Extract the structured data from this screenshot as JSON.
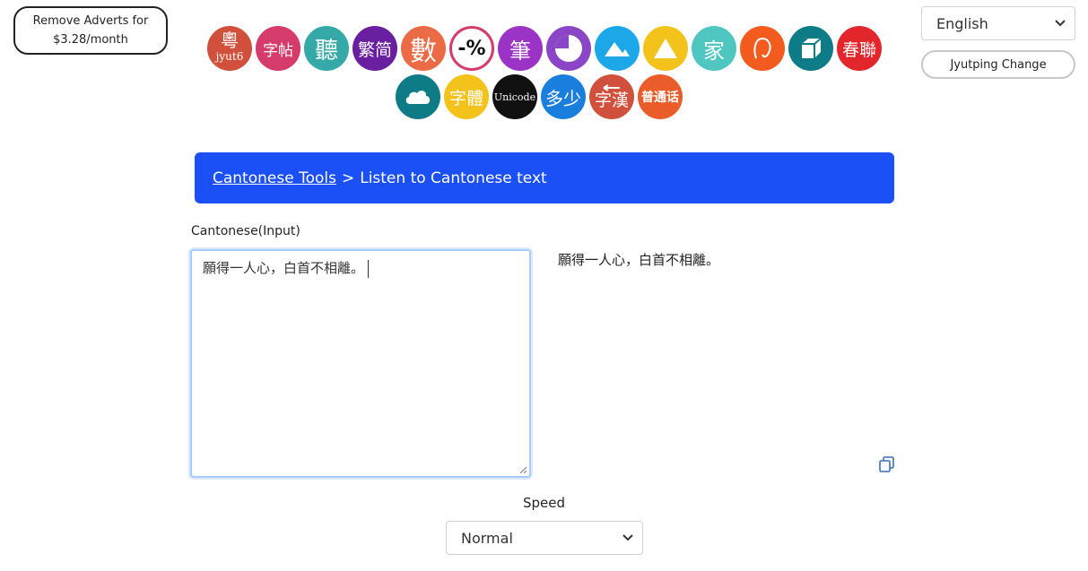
{
  "header": {
    "remove_ads_line1": "Remove Adverts for",
    "remove_ads_line2": "$3.28/month",
    "language": "English",
    "jyutping_button": "Jyutping Change"
  },
  "tool_icons": [
    {
      "name": "jyutping-tool-icon",
      "text": "粵",
      "sub": "jyut6",
      "color": "#d0503c"
    },
    {
      "name": "calligraphy-sheet-icon",
      "text": "字帖",
      "color": "#d53b6b"
    },
    {
      "name": "listen-icon",
      "text": "聽",
      "color": "#35a8a8"
    },
    {
      "name": "traditional-simplified-icon",
      "text": "繁简",
      "color": "#6a1fa0"
    },
    {
      "name": "numbers-icon",
      "text": "數",
      "color": "#ea6b45"
    },
    {
      "name": "percent-icon",
      "text": "-%",
      "color": "#ffffff"
    },
    {
      "name": "stroke-icon",
      "text": "筆",
      "color": "#9b33c6"
    },
    {
      "name": "pie-chart-icon",
      "text": "",
      "color": "#8a46c7"
    },
    {
      "name": "mountains-icon",
      "text": "",
      "color": "#1ba7e8"
    },
    {
      "name": "triangle-icon",
      "text": "",
      "color": "#f3c21b"
    },
    {
      "name": "family-icon",
      "text": "家",
      "color": "#4fc6c0"
    },
    {
      "name": "swirl-icon",
      "text": "",
      "color": "#f35c1e"
    },
    {
      "name": "cube-icon",
      "text": "",
      "color": "#0d7c86"
    },
    {
      "name": "spring-couplet-icon",
      "text": "春聯",
      "color": "#e3262b"
    },
    {
      "name": "cloud-icon",
      "text": "",
      "color": "#0d7c86"
    },
    {
      "name": "font-icon",
      "text": "字體",
      "color": "#f3c21b"
    },
    {
      "name": "unicode-icon",
      "text": "Unicode",
      "color": "#111111"
    },
    {
      "name": "count-icon",
      "text": "多少",
      "color": "#1a7fdc"
    },
    {
      "name": "chinese-character-icon",
      "text": "字漢",
      "color": "#d0503c"
    },
    {
      "name": "mandarin-icon",
      "text": "普通话",
      "color": "#ea5d2a"
    }
  ],
  "breadcrumb": {
    "link": "Cantonese Tools",
    "separator": ">",
    "current": "Listen to Cantonese text"
  },
  "input": {
    "label": "Cantonese(Input)",
    "value": "願得一人心，白首不相離。"
  },
  "output": {
    "text": "願得一人心，白首不相離。"
  },
  "speed": {
    "label": "Speed",
    "value": "Normal"
  }
}
